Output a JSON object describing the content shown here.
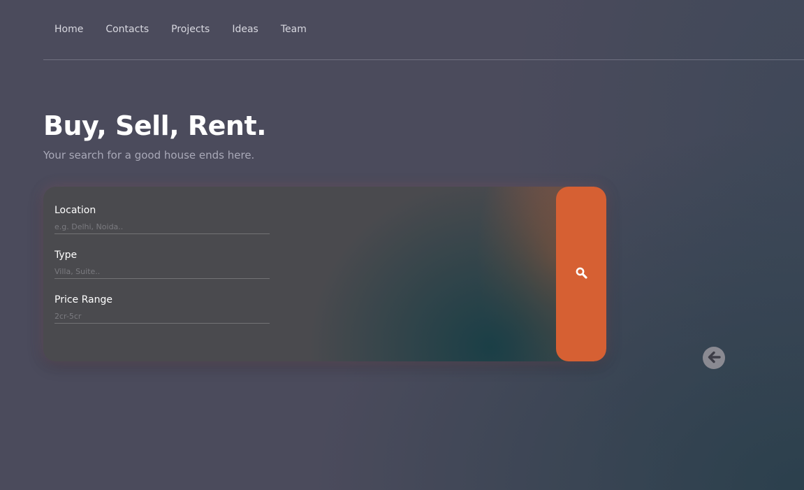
{
  "nav": {
    "items": [
      {
        "label": "Home"
      },
      {
        "label": "Contacts"
      },
      {
        "label": "Projects"
      },
      {
        "label": "Ideas"
      },
      {
        "label": "Team"
      }
    ]
  },
  "hero": {
    "title": "Buy, Sell, Rent.",
    "subtitle": "Your search for a good house ends here."
  },
  "search_form": {
    "location": {
      "label": "Location",
      "placeholder": "e.g. Delhi, Noida..",
      "value": ""
    },
    "type": {
      "label": "Type",
      "placeholder": "Villa, Suite..",
      "value": ""
    },
    "price_range": {
      "label": "Price Range",
      "placeholder": "2cr-5cr",
      "value": ""
    },
    "search_button_icon": "search-icon"
  },
  "back_button": {
    "icon": "arrow-left-circle-icon"
  },
  "colors": {
    "accent": "#d66033",
    "background": "#4b4b5c",
    "card": "#4a4a4e"
  }
}
